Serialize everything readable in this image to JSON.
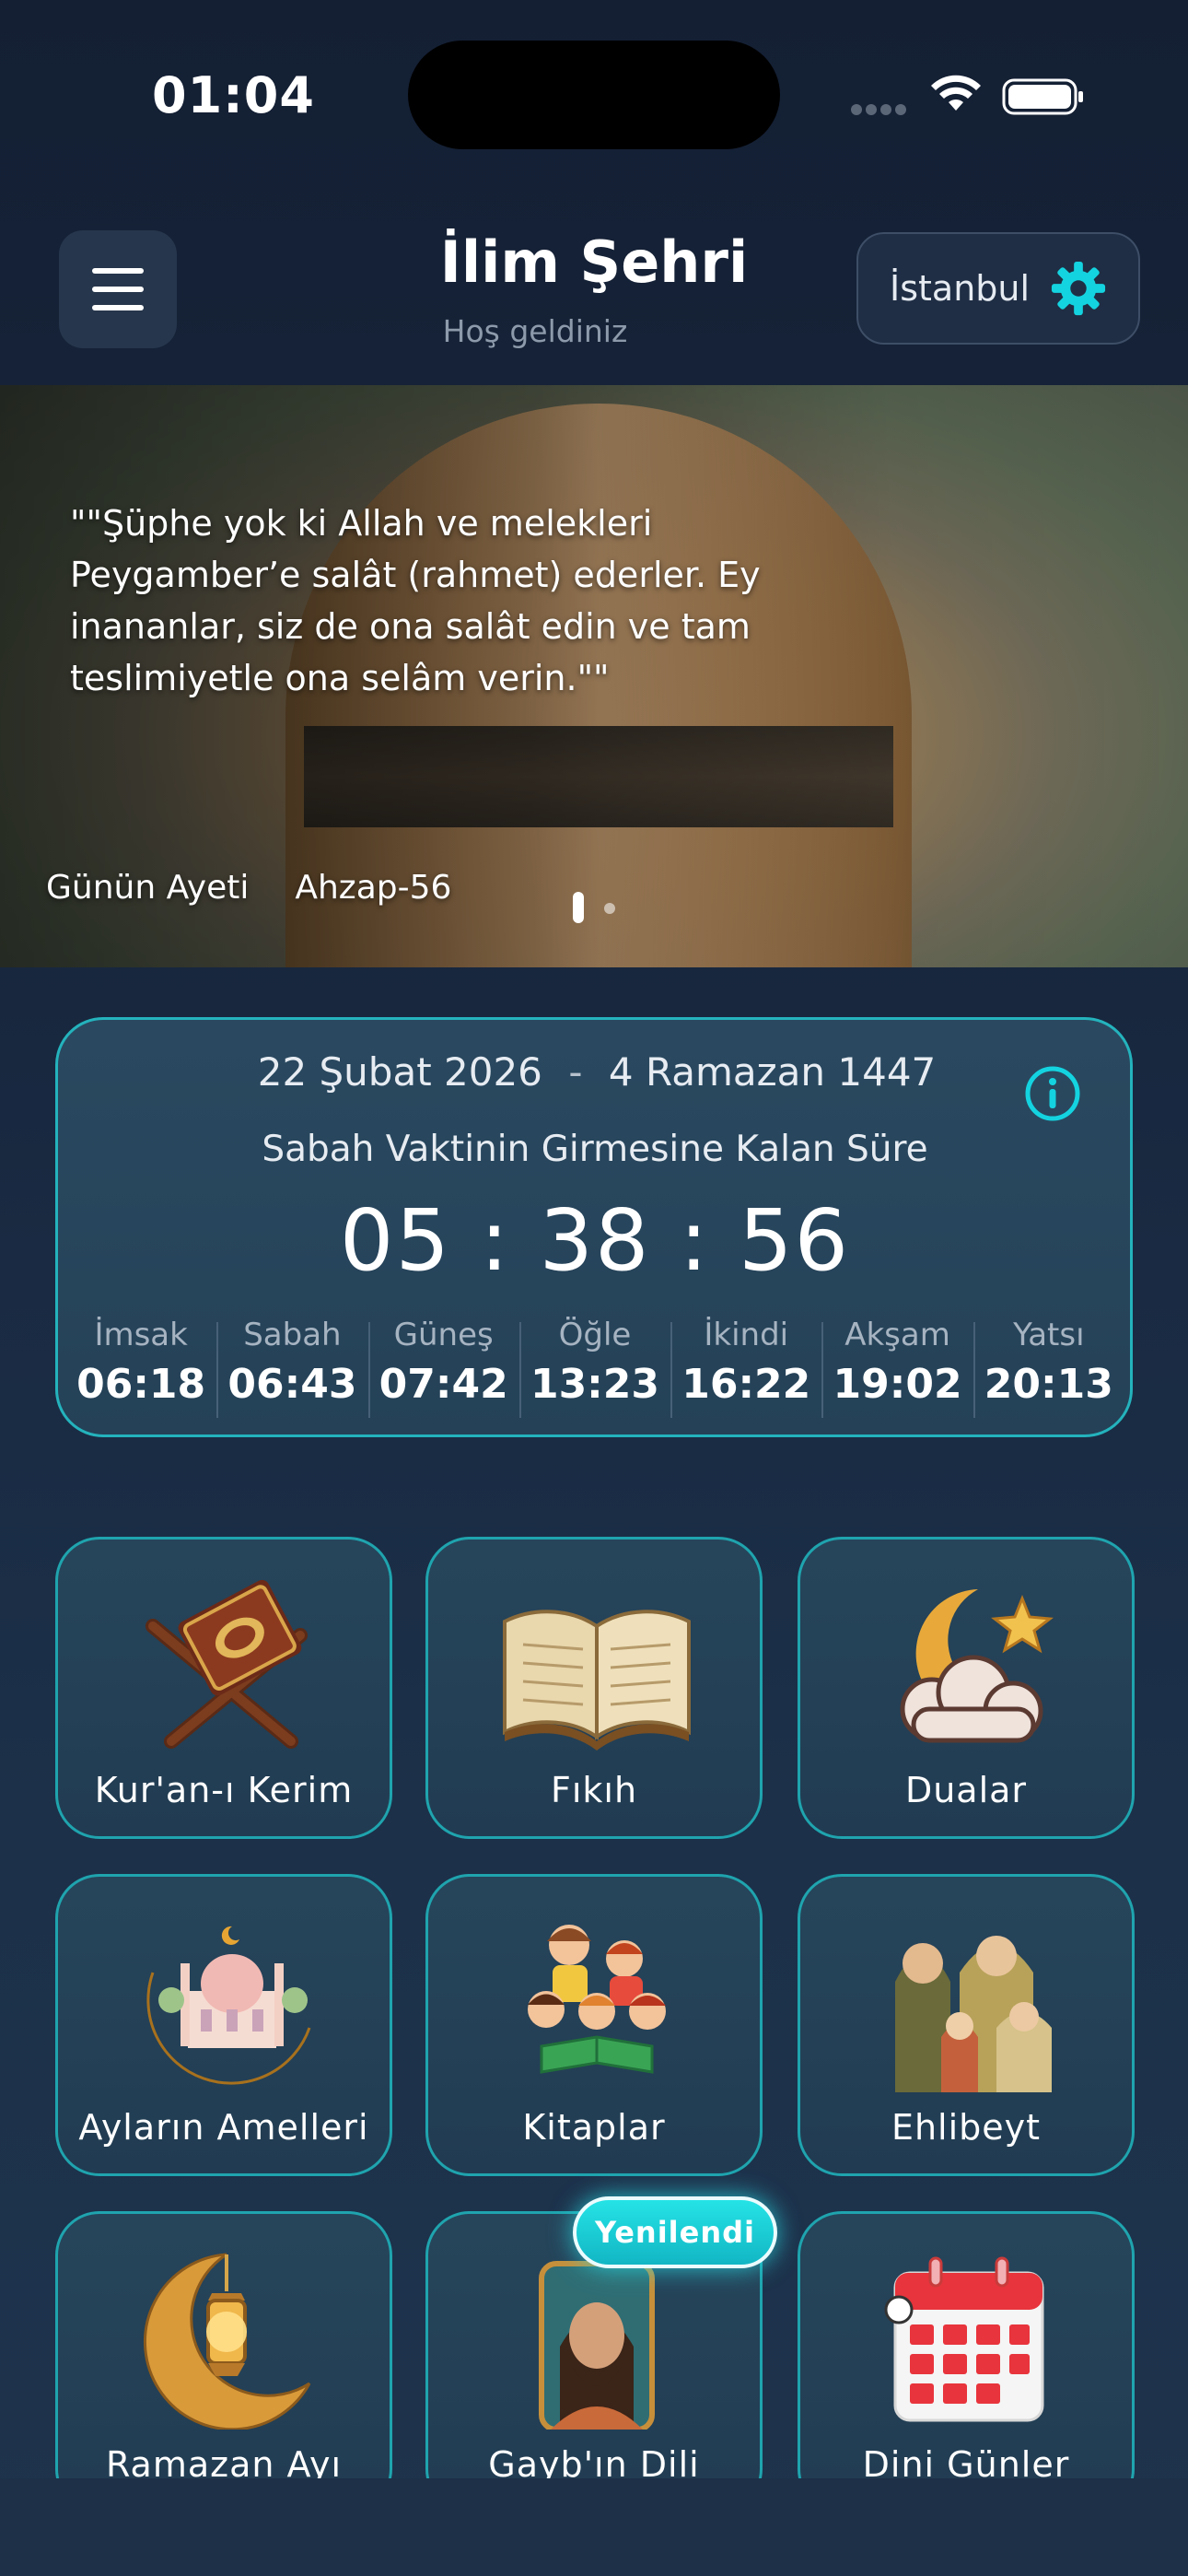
{
  "status_bar": {
    "time": "01:04"
  },
  "header": {
    "title": "İlim Şehri",
    "subtitle": "Hoş geldiniz",
    "city": "İstanbul"
  },
  "banner": {
    "quote": "\"\"Şüphe yok ki Allah ve melekleri Peygamber’e salât (rahmet) ederler. Ey inananlar, siz de ona salât edin ve tam teslimiyetle ona selâm verin.\"\"",
    "label": "Günün Ayeti",
    "reference": "Ahzap-56",
    "page_indicator": {
      "active": 1,
      "total": 2
    }
  },
  "prayer_card": {
    "gregorian_date": "22 Şubat 2026",
    "separator": "-",
    "hijri_date": "4 Ramazan 1447",
    "countdown_label": "Sabah Vaktinin Girmesine Kalan Süre",
    "countdown": "05 : 38 : 56",
    "times": [
      {
        "name": "İmsak",
        "time": "06:18"
      },
      {
        "name": "Sabah",
        "time": "06:43"
      },
      {
        "name": "Güneş",
        "time": "07:42"
      },
      {
        "name": "Öğle",
        "time": "13:23"
      },
      {
        "name": "İkindi",
        "time": "16:22"
      },
      {
        "name": "Akşam",
        "time": "19:02"
      },
      {
        "name": "Yatsı",
        "time": "20:13"
      }
    ]
  },
  "grid": [
    {
      "label": "Kur'an-ı Kerim",
      "icon": "quran-stand-icon"
    },
    {
      "label": "Fıkıh",
      "icon": "open-book-icon"
    },
    {
      "label": "Dualar",
      "icon": "crescent-cloud-icon"
    },
    {
      "label": "Ayların Amelleri",
      "icon": "mosque-crescent-icon"
    },
    {
      "label": "Kitaplar",
      "icon": "children-reading-icon"
    },
    {
      "label": "Ehlibeyt",
      "icon": "family-icon"
    },
    {
      "label": "Ramazan Ayı",
      "icon": "crescent-lantern-icon"
    },
    {
      "label": "Gayb'ın Dili",
      "icon": "portrait-icon"
    },
    {
      "label": "Dini Günler",
      "icon": "calendar-icon"
    }
  ],
  "badge": "Yenilendi",
  "colors": {
    "accent": "#21b4bf",
    "background": "#16233a",
    "card": "#244157"
  }
}
